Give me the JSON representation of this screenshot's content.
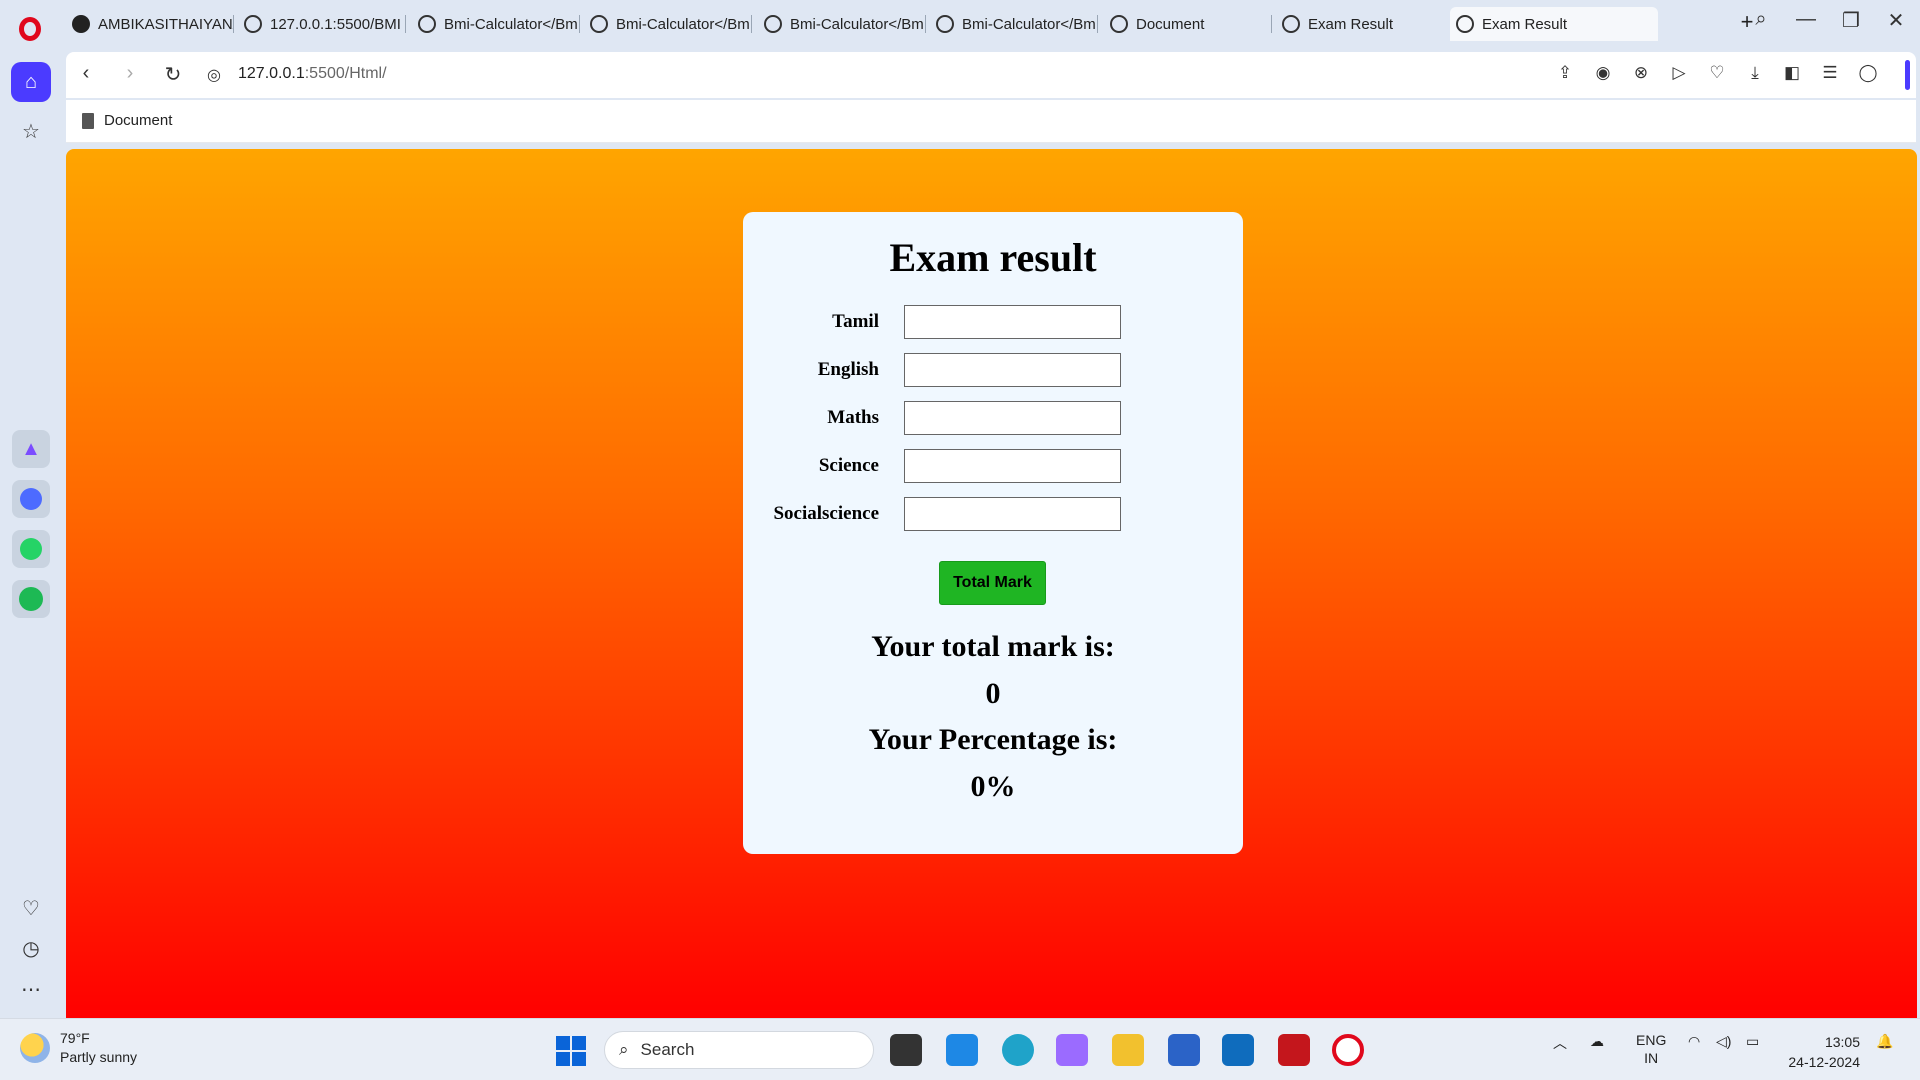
{
  "tabs": [
    {
      "label": "AMBIKASITHAIYAN/",
      "icon": "github-icon"
    },
    {
      "label": "127.0.0.1:5500/BMI",
      "icon": "globe-icon"
    },
    {
      "label": "Bmi-Calculator</Bm",
      "icon": "globe-icon"
    },
    {
      "label": "Bmi-Calculator</Bm",
      "icon": "globe-icon"
    },
    {
      "label": "Bmi-Calculator</Bm",
      "icon": "globe-icon"
    },
    {
      "label": "Bmi-Calculator</Bm",
      "icon": "globe-icon"
    },
    {
      "label": "Document",
      "icon": "globe-icon"
    },
    {
      "label": "Exam Result",
      "icon": "globe-icon"
    },
    {
      "label": "Exam Result",
      "icon": "globe-icon"
    }
  ],
  "address": {
    "host": "127.0.0.1",
    "path": ":5500/Html/"
  },
  "bookmarks": [
    {
      "label": "Document"
    }
  ],
  "page": {
    "title": "Exam result",
    "fields": [
      {
        "label": "Tamil",
        "value": ""
      },
      {
        "label": "English",
        "value": ""
      },
      {
        "label": "Maths",
        "value": ""
      },
      {
        "label": "Science",
        "value": ""
      },
      {
        "label": "Socialscience",
        "value": ""
      }
    ],
    "button_label": "Total Mark",
    "total_label": "Your total mark is:",
    "total_value": "0",
    "percentage_label": "Your Percentage is:",
    "percentage_value": "0%"
  },
  "taskbar": {
    "weather_temp": "79°F",
    "weather_desc": "Partly sunny",
    "search_placeholder": "Search",
    "lang_top": "ENG",
    "lang_bottom": "IN",
    "time": "13:05",
    "date": "24-12-2024"
  },
  "colors": {
    "gradient_top": "#ffa500",
    "gradient_bottom": "#ff0000",
    "button_green": "#1fb523",
    "card_bg": "#f0f8ff",
    "accent": "#4b3bff"
  }
}
